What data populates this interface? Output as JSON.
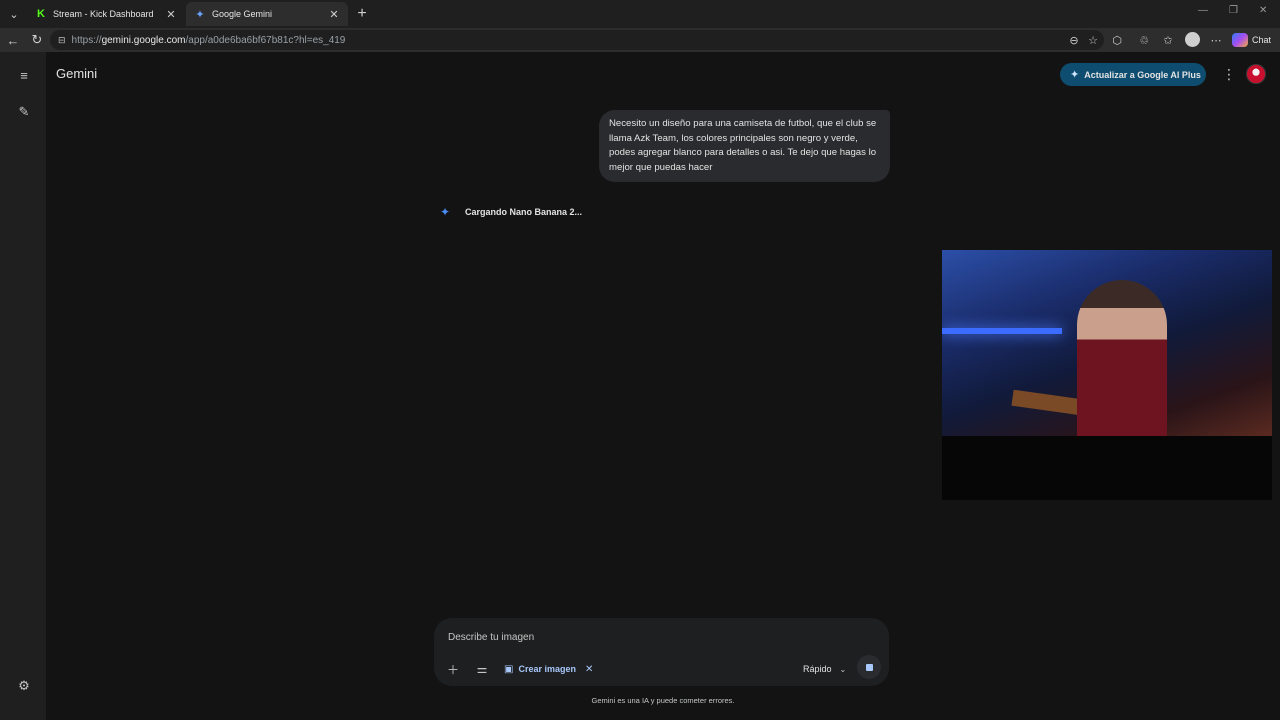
{
  "browser": {
    "tabs": [
      {
        "title": "Stream - Kick Dashboard",
        "favicon": "kick-icon",
        "active": false
      },
      {
        "title": "Google Gemini",
        "favicon": "gemini-icon",
        "active": true
      }
    ],
    "url_prefix": "https://",
    "url_host": "gemini.google.com",
    "url_path": "/app/a0de6ba6bf67b81c?hl=es_419",
    "chat_label": "Chat"
  },
  "app": {
    "brand": "Gemini",
    "upgrade_label": "Actualizar a Google AI Plus",
    "colors": {
      "accent": "#0e4d70",
      "link": "#a8c7fa",
      "kick": "#53fc18"
    }
  },
  "conversation": {
    "user_message": "Necesito un diseño para una camiseta de futbol, que el club se llama Azk Team, los colores principales son negro y verde, podes agregar blanco para detalles o asi. Te dejo que hagas lo mejor que puedas hacer",
    "loading_text": "Cargando Nano Banana 2..."
  },
  "composer": {
    "placeholder": "Describe tu imagen",
    "tool_chip": "Crear imagen",
    "mode": "Rápido"
  },
  "footer": {
    "disclaimer": "Gemini es una IA y puede cometer errores."
  }
}
